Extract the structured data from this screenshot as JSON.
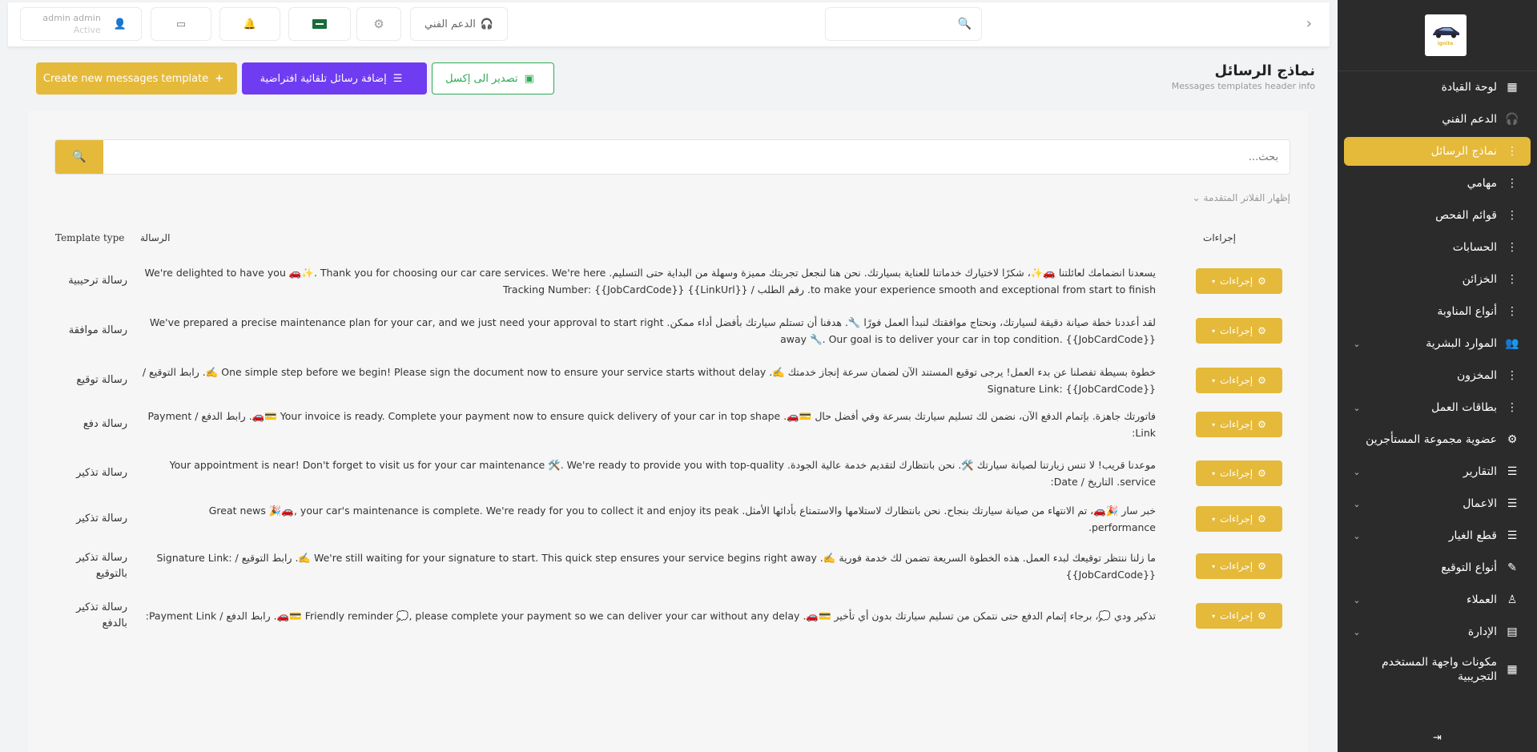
{
  "sidebar": {
    "brand": "ignite",
    "items": [
      {
        "label": "لوحة القيادة",
        "icon": "grid-icon",
        "glyph": "▦",
        "chevron": false
      },
      {
        "label": "الدعم الفني",
        "icon": "headset-icon",
        "glyph": "🎧",
        "chevron": false
      },
      {
        "label": "نماذج الرسائل",
        "icon": "dots-icon",
        "glyph": "⋮",
        "chevron": false,
        "active": true
      },
      {
        "label": "مهامي",
        "icon": "dots-icon",
        "glyph": "⋮",
        "chevron": false
      },
      {
        "label": "قوائم الفحص",
        "icon": "dots-icon",
        "glyph": "⋮",
        "chevron": false
      },
      {
        "label": "الحسابات",
        "icon": "dots-icon",
        "glyph": "⋮",
        "chevron": false
      },
      {
        "label": "الخزائن",
        "icon": "dots-icon",
        "glyph": "⋮",
        "chevron": false
      },
      {
        "label": "أنواع المناوبة",
        "icon": "dots-icon",
        "glyph": "⋮",
        "chevron": false
      },
      {
        "label": "الموارد البشرية",
        "icon": "users-icon",
        "glyph": "👥",
        "chevron": true
      },
      {
        "label": "المخزون",
        "icon": "dots-icon",
        "glyph": "⋮",
        "chevron": false
      },
      {
        "label": "بطاقات العمل",
        "icon": "dots-icon",
        "glyph": "⋮",
        "chevron": true
      },
      {
        "label": "عضوية مجموعة المستأجرين",
        "icon": "network-icon",
        "glyph": "⚙",
        "chevron": false
      },
      {
        "label": "التقارير",
        "icon": "sliders-icon",
        "glyph": "☰",
        "chevron": true
      },
      {
        "label": "الاعمال",
        "icon": "sliders-icon",
        "glyph": "☰",
        "chevron": true
      },
      {
        "label": "قطع الغيار",
        "icon": "sliders-icon",
        "glyph": "☰",
        "chevron": true
      },
      {
        "label": "أنواع التوقيع",
        "icon": "pencil-icon",
        "glyph": "✎",
        "chevron": false
      },
      {
        "label": "العملاء",
        "icon": "user-tie-icon",
        "glyph": "♙",
        "chevron": true
      },
      {
        "label": "الإدارة",
        "icon": "admin-icon",
        "glyph": "▤",
        "chevron": true
      },
      {
        "label": "مكونات واجهة المستخدم التجريبية",
        "icon": "components-icon",
        "glyph": "▦",
        "chevron": false,
        "tall": true
      }
    ]
  },
  "topbar": {
    "user_name": "admin admin",
    "user_status": "Active",
    "support_label": "الدعم الفني"
  },
  "page": {
    "title": "نماذج الرسائل",
    "subtitle": "Messages templates header info",
    "create_label": "Create new messages template",
    "defaults_label": "إضافة رسائل تلقائية افتراضية",
    "export_label": "تصدير الى إكسل",
    "search_placeholder": "بحث...",
    "advanced_filters": "إظهار الفلاتر المتقدمة"
  },
  "table": {
    "headers": {
      "type": "Template type",
      "message": "الرسالة",
      "actions": "إجراءات"
    },
    "action_label": "إجراءات",
    "rows": [
      {
        "type": "رسالة ترحيبية",
        "message": "يسعدنا انضمامك لعائلتنا 🚗✨، شكرًا لاختيارك خدماتنا للعناية بسيارتك. نحن هنا لنجعل تجربتك مميزة وسهلة من البداية حتى التسليم. We're delighted to have you 🚗✨. Thank you for choosing our car care services. We're here to make your experience smooth and exceptional from start to finish. رقم الطلب / Tracking Number: {{JobCardCode}} {{LinkUrl}}"
      },
      {
        "type": "رسالة موافقة",
        "message": "لقد أعددنا خطة صيانة دقيقة لسيارتك، ونحتاج موافقتك لنبدأ العمل فورًا 🔧. هدفنا أن تستلم سيارتك بأفضل أداء ممكن. We've prepared a precise maintenance plan for your car, and we just need your approval to start right away 🔧. Our goal is to deliver your car in top condition. {{JobCardCode}}"
      },
      {
        "type": "رسالة توقيع",
        "message": "خطوة بسيطة تفصلنا عن بدء العمل! يرجى توقيع المستند الآن لضمان سرعة إنجاز خدمتك ✍️. One simple step before we begin! Please sign the document now to ensure your service starts without delay ✍️. رابط التوقيع / Signature Link: {{JobCardCode}}"
      },
      {
        "type": "رسالة دفع",
        "message": "فاتورتك جاهزة. بإتمام الدفع الآن، نضمن لك تسليم سيارتك بسرعة وفي أفضل حال 💳🚗. Your invoice is ready. Complete your payment now to ensure quick delivery of your car in top shape 💳🚗. رابط الدفع / Payment Link:"
      },
      {
        "type": "رسالة تذكير",
        "message": "موعدنا قريب! لا تنس زيارتنا لصيانة سيارتك 🛠️. نحن بانتظارك لتقديم خدمة عالية الجودة. Your appointment is near! Don't forget to visit us for your car maintenance 🛠️. We're ready to provide you with top-quality service. التاريخ / Date:"
      },
      {
        "type": "رسالة تذكير",
        "message": "خبر سار 🎉🚗، تم الانتهاء من صيانة سيارتك بنجاح. نحن بانتظارك لاستلامها والاستمتاع بأدائها الأمثل. Great news 🎉🚗, your car's maintenance is complete. We're ready for you to collect it and enjoy its peak performance."
      },
      {
        "type": "رسالة تذكير بالتوقيع",
        "message": "ما زلنا ننتظر توقيعك لبدء العمل. هذه الخطوة السريعة تضمن لك خدمة فورية ✍️. We're still waiting for your signature to start. This quick step ensures your service begins right away ✍️. رابط التوقيع / Signature Link: {{JobCardCode}}"
      },
      {
        "type": "رسالة تذكير بالدفع",
        "message": "تذكير ودي 💭، برجاء إتمام الدفع حتى نتمكن من تسليم سيارتك بدون أي تأخير 💳🚗. Friendly reminder 💭, please complete your payment so we can deliver your car without any delay 💳🚗. رابط الدفع / Payment Link:"
      }
    ]
  }
}
